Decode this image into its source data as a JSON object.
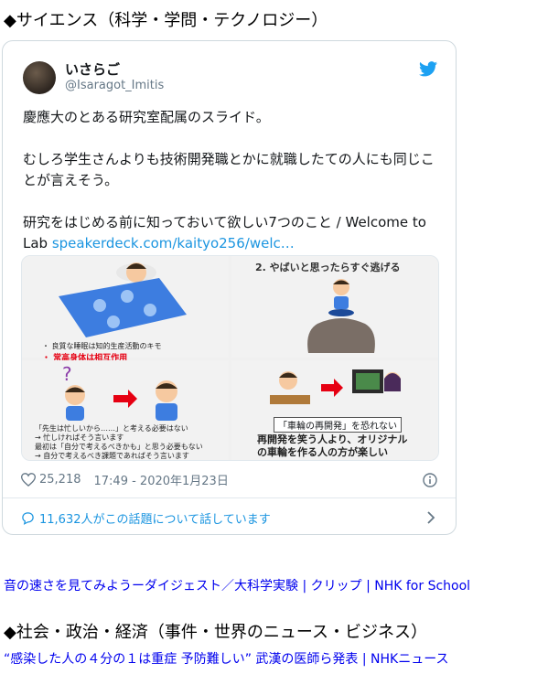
{
  "sections": {
    "science_title": "◆サイエンス（科学・学問・テクノロジー）",
    "society_title": "◆社会・政治・経済（事件・世界のニュース・ビジネス）"
  },
  "tweet": {
    "author_name": "いさらご",
    "author_handle": "@Isaragot_Imitis",
    "text_line1": "慶應大のとある研究室配属のスライド。",
    "text_line2": "むしろ学生さんよりも技術開発職とかに就職したての人にも同じことが言えそう。",
    "text_line3": "研究をはじめる前に知っておいて欲しい7つのこと / Welcome to Lab ",
    "link_text": "speakerdeck.com/kaityo256/welc…",
    "likes": "25,218",
    "timestamp": "17:49 - 2020年1月23日",
    "conversation": "11,632人がこの話題について話しています",
    "accent_color": "#1b95e0",
    "media": {
      "q1_text": "・ 良質な睡眠は知的生産活動のキモ",
      "q1_red": "・ 常高身体は相互作用",
      "q2_title": "2. やばいと思ったらすぐ逃げる",
      "q3_text1": "「先生は忙しいから……」と考える必要はない",
      "q3_text2": "→ 忙しければそう言います",
      "q3_text3": "最初は「自分で考えるべきかも」と思う必要もない",
      "q3_text4": "→ 自分で考えるべき課題であればそう言います",
      "q4_box": "「車輪の再開発」を恐れない",
      "q4_text1": "再開発を笑う人より、オリジナル",
      "q4_text2": "の車輪を作る人の方が楽しい"
    }
  },
  "links": {
    "science_link": "音の速さを見てみようーダイジェスト／大科学実験 | クリップ | NHK for School",
    "society_link": "“感染した人の４分の１は重症 予防難しい” 武漢の医師ら発表 | NHKニュース"
  }
}
